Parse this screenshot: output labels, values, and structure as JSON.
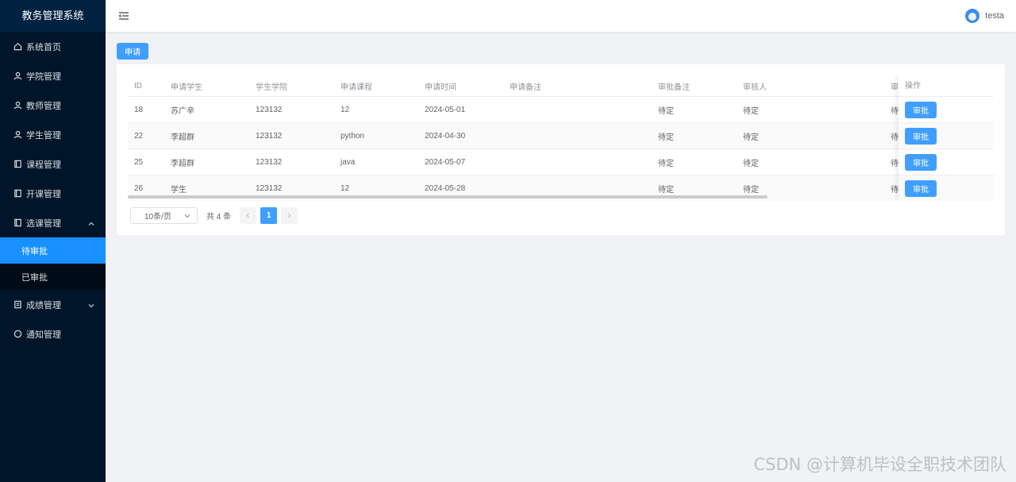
{
  "app": {
    "title": "教务管理系统"
  },
  "sidebar": {
    "items": [
      {
        "label": "系统首页",
        "icon": "home-icon"
      },
      {
        "label": "学院管理",
        "icon": "user-icon"
      },
      {
        "label": "教师管理",
        "icon": "user-icon"
      },
      {
        "label": "学生管理",
        "icon": "user-icon"
      },
      {
        "label": "课程管理",
        "icon": "book-icon"
      },
      {
        "label": "开课管理",
        "icon": "book-icon"
      },
      {
        "label": "选课管理",
        "icon": "book-icon",
        "expanded": true
      },
      {
        "label": "成绩管理",
        "icon": "document-icon",
        "expanded": false
      },
      {
        "label": "通知管理",
        "icon": "chat-icon"
      }
    ],
    "sub_items": [
      {
        "label": "待审批",
        "active": true
      },
      {
        "label": "已审批",
        "active": false
      }
    ]
  },
  "header": {
    "username": "testa"
  },
  "toolbar": {
    "apply_label": "申请"
  },
  "table": {
    "columns": [
      "ID",
      "申请学生",
      "学生学院",
      "申请课程",
      "申请时间",
      "申请备注",
      "审批备注",
      "审核人",
      "审",
      "操作"
    ],
    "rows": [
      {
        "id": "18",
        "student": "苏广辛",
        "college": "123132",
        "course": "12",
        "time": "2024-05-01",
        "note": "",
        "audit_note": "待定",
        "auditor": "待定",
        "status": "待",
        "action": "审批"
      },
      {
        "id": "22",
        "student": "李超群",
        "college": "123132",
        "course": "python",
        "time": "2024-04-30",
        "note": "",
        "audit_note": "待定",
        "auditor": "待定",
        "status": "待",
        "action": "审批"
      },
      {
        "id": "25",
        "student": "李超群",
        "college": "123132",
        "course": "java",
        "time": "2024-05-07",
        "note": "",
        "audit_note": "待定",
        "auditor": "待定",
        "status": "待",
        "action": "审批"
      },
      {
        "id": "26",
        "student": "学生",
        "college": "123132",
        "course": "12",
        "time": "2024-05-28",
        "note": "",
        "audit_note": "待定",
        "auditor": "待定",
        "status": "待",
        "action": "审批"
      }
    ]
  },
  "pagination": {
    "page_size": "10条/页",
    "total": "共 4 条",
    "current": "1"
  },
  "watermark": "CSDN @计算机毕设全职技术团队",
  "colors": {
    "sidebar_bg": "#001529",
    "accent": "#1890ff",
    "button": "#409eff"
  }
}
